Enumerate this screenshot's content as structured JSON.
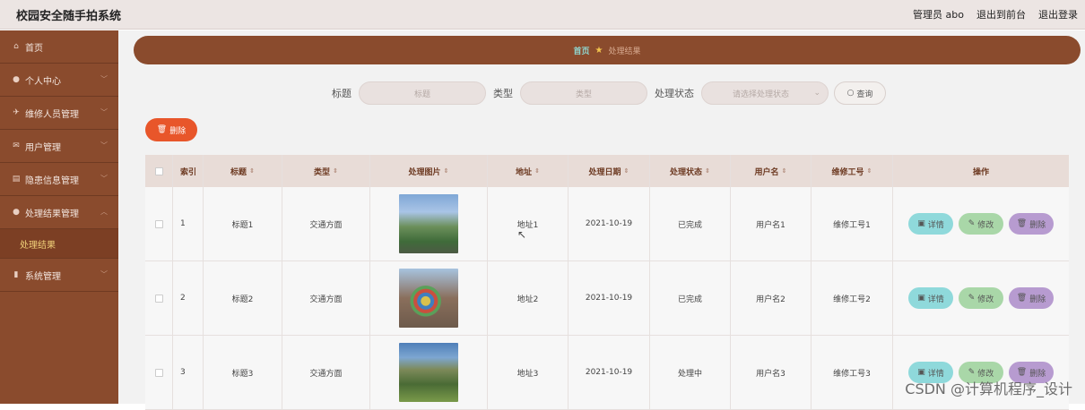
{
  "app_title": "校园安全随手拍系统",
  "top_nav": {
    "user": "管理员 abo",
    "frontend": "退出到前台",
    "logout": "退出登录"
  },
  "sidebar": {
    "items": [
      {
        "label": "首页",
        "icon": "home-icon"
      },
      {
        "label": "个人中心",
        "icon": "person-icon"
      },
      {
        "label": "维修人员管理",
        "icon": "wrench-icon"
      },
      {
        "label": "用户管理",
        "icon": "mail-icon"
      },
      {
        "label": "隐患信息管理",
        "icon": "document-icon"
      },
      {
        "label": "处理结果管理",
        "icon": "person-icon"
      },
      {
        "label": "系统管理",
        "icon": "chart-icon"
      }
    ],
    "sub_item": "处理结果"
  },
  "breadcrumb": {
    "home": "首页",
    "current": "处理结果"
  },
  "search": {
    "title_label": "标题",
    "title_placeholder": "标题",
    "type_label": "类型",
    "type_placeholder": "类型",
    "status_label": "处理状态",
    "status_placeholder": "请选择处理状态",
    "query_button": "查询"
  },
  "delete_button": "删除",
  "table": {
    "headers": {
      "index": "索引",
      "title": "标题",
      "type": "类型",
      "image": "处理图片",
      "address": "地址",
      "date": "处理日期",
      "status": "处理状态",
      "user": "用户名",
      "worker": "维修工号",
      "actions": "操作"
    },
    "rows": [
      {
        "index": "1",
        "title": "标题1",
        "type": "交通方面",
        "address": "地址1",
        "date": "2021-10-19",
        "status": "已完成",
        "user": "用户名1",
        "worker": "维修工号1"
      },
      {
        "index": "2",
        "title": "标题2",
        "type": "交通方面",
        "address": "地址2",
        "date": "2021-10-19",
        "status": "已完成",
        "user": "用户名2",
        "worker": "维修工号2"
      },
      {
        "index": "3",
        "title": "标题3",
        "type": "交通方面",
        "address": "地址3",
        "date": "2021-10-19",
        "status": "处理中",
        "user": "用户名3",
        "worker": "维修工号3"
      }
    ],
    "actions": {
      "detail": "详情",
      "edit": "修改",
      "delete": "删除"
    }
  },
  "watermark": "CSDN @计算机程序_设计",
  "colors": {
    "sidebar": "#8a4b2d",
    "accent_delete": "#e8562a",
    "header_row": "#e8dcd7",
    "detail": "#8fd9db",
    "edit": "#a9d7a8",
    "remove": "#b79bd0"
  }
}
